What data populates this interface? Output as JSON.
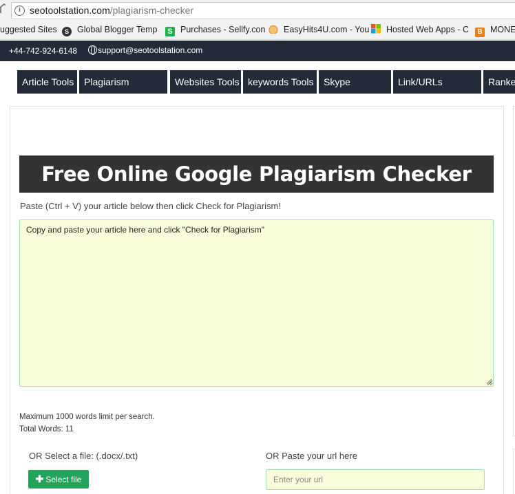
{
  "browser": {
    "url_host": "seotoolstation.com",
    "url_path": "/plagiarism-checker",
    "bookmarks": [
      {
        "label": "uggested Sites",
        "icon": "none",
        "color": ""
      },
      {
        "label": "Global Blogger Temp",
        "icon": "s-circle-icon",
        "color": "#333333"
      },
      {
        "label": "Purchases - Sellfy.con",
        "icon": "sellfy-icon",
        "color": "#21b04b"
      },
      {
        "label": "EasyHits4U.com - You",
        "icon": "hand-icon",
        "color": "#f2a33a"
      },
      {
        "label": "Hosted Web Apps - C",
        "icon": "windows-icon",
        "color": "#f25022"
      },
      {
        "label": "MONE",
        "icon": "blogger-icon",
        "color": "#f57d00"
      }
    ]
  },
  "topbar": {
    "phone": "+44-742-924-6148",
    "email": "support@seotoolstation.com"
  },
  "nav": [
    "Article Tools",
    "Plagiarism Checker",
    "Websites Tools",
    "keywords Tools",
    "Skype Resolver",
    "Link/URLs Analyzer",
    "Ranke"
  ],
  "main": {
    "title": "Free Online Google Plagiarism Checker Tool",
    "instruction": "Paste (Ctrl + V) your article below then click Check for Plagiarism!",
    "article_placeholder": "Copy and paste your article here and click \"Check for Plagiarism\"",
    "limit_text": "Maximum 1000 words limit per search.",
    "total_words_text": "Total Words: 11",
    "file_label": "OR Select a file: (.docx/.txt)",
    "select_file_label": "Select file",
    "url_label": "OR Paste your url here",
    "url_placeholder": "Enter your url"
  },
  "colors": {
    "dark_bar": "#232b38",
    "title_bg": "#333333",
    "input_bg": "#f9fdd9",
    "button_green": "#21a55c"
  }
}
